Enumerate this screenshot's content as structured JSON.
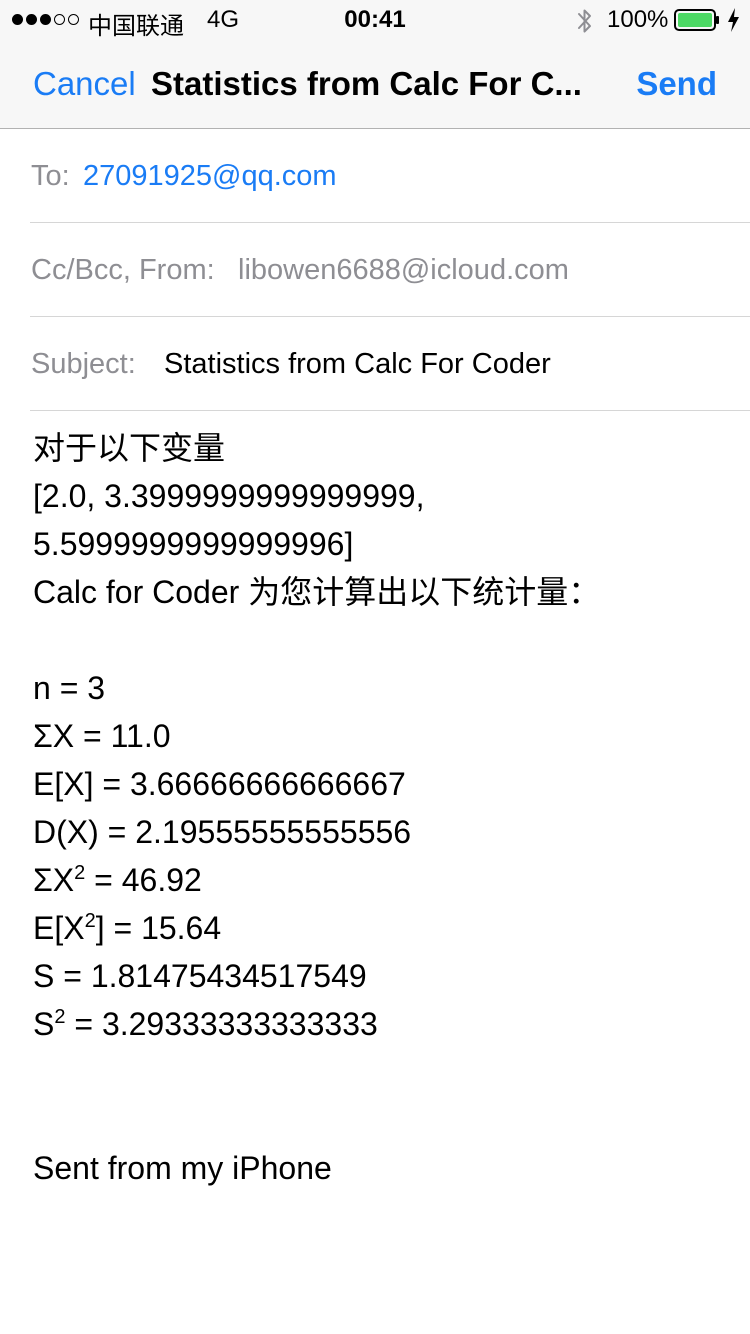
{
  "status_bar": {
    "carrier": "中国联通",
    "network": "4G",
    "time": "00:41",
    "battery_percent": "100%",
    "signal_bars_filled": 3,
    "signal_bars_total": 5,
    "battery_color": "#4cd964"
  },
  "nav": {
    "cancel_label": "Cancel",
    "title": "Statistics from Calc For C...",
    "send_label": "Send",
    "accent_color": "#1a7cf5"
  },
  "header": {
    "to_label": "To:",
    "to_value": "27091925@qq.com",
    "cc_label": "Cc/Bcc, From:",
    "cc_value": "libowen6688@icloud.com",
    "subject_label": "Subject:",
    "subject_value": "Statistics from Calc For Coder"
  },
  "body": {
    "intro": "对于以下变量",
    "values_line1": "[2.0, 3.3999999999999999,",
    "values_line2": "5.5999999999999996]",
    "summary": "Calc for Coder 为您计算出以下统计量：",
    "n": "n = 3",
    "sum_x": "ΣX = 11.0",
    "mean": "E[X] = 3.66666666666667",
    "variance": "D(X) = 2.19555555555556",
    "sum_x2_prefix": "ΣX",
    "sum_x2_sup": "2",
    "sum_x2_rest": " = 46.92",
    "mean_x2_prefix": "E[X",
    "mean_x2_sup": "2",
    "mean_x2_rest": "] = 15.64",
    "std": "S = 1.81475434517549",
    "s2_prefix": "S",
    "s2_sup": "2",
    "s2_rest": " = 3.29333333333333",
    "signature": "Sent from my iPhone"
  }
}
